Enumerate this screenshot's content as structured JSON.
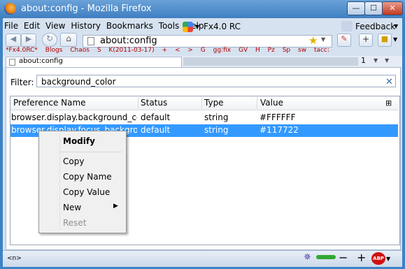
{
  "window": {
    "title": "about:config - Mozilla Firefox"
  },
  "menubar": {
    "items": [
      "File",
      "Edit",
      "View",
      "History",
      "Bookmarks",
      "Tools",
      "Help"
    ],
    "fx_label": "Fx4.0 RC",
    "feedback": "Feedback"
  },
  "url": "about:config",
  "bookmarks": [
    "*Fx4.0RC*",
    "Blogs",
    "Chaos",
    "S",
    "K(2011-03-17)",
    "+",
    "<",
    ">",
    "G",
    "gg:fix",
    "GV",
    "H",
    "Pz",
    "Sp",
    "sw",
    "tacc:"
  ],
  "tab": {
    "label": "about:config",
    "count": "1"
  },
  "filter": {
    "label": "Filter:",
    "value": "background_color"
  },
  "table": {
    "columns": [
      "Preference Name",
      "Status",
      "Type",
      "Value"
    ],
    "rows": [
      {
        "name": "browser.display.background_col...",
        "status": "default",
        "type": "string",
        "value": "#FFFFFF"
      },
      {
        "name": "browser.display.focus_backgrou...",
        "status": "default",
        "type": "string",
        "value": "#117722"
      }
    ]
  },
  "context_menu": {
    "items": [
      "Modify",
      "Copy",
      "Copy Name",
      "Copy Value",
      "New",
      "Reset"
    ]
  },
  "statusbar": {
    "left_label": "<n>",
    "zoom_minus": "−",
    "zoom_plus": "+",
    "abp_label": "ABP"
  },
  "colors": {
    "selection": "#3399ff",
    "titlebar": "#4d8acb"
  }
}
